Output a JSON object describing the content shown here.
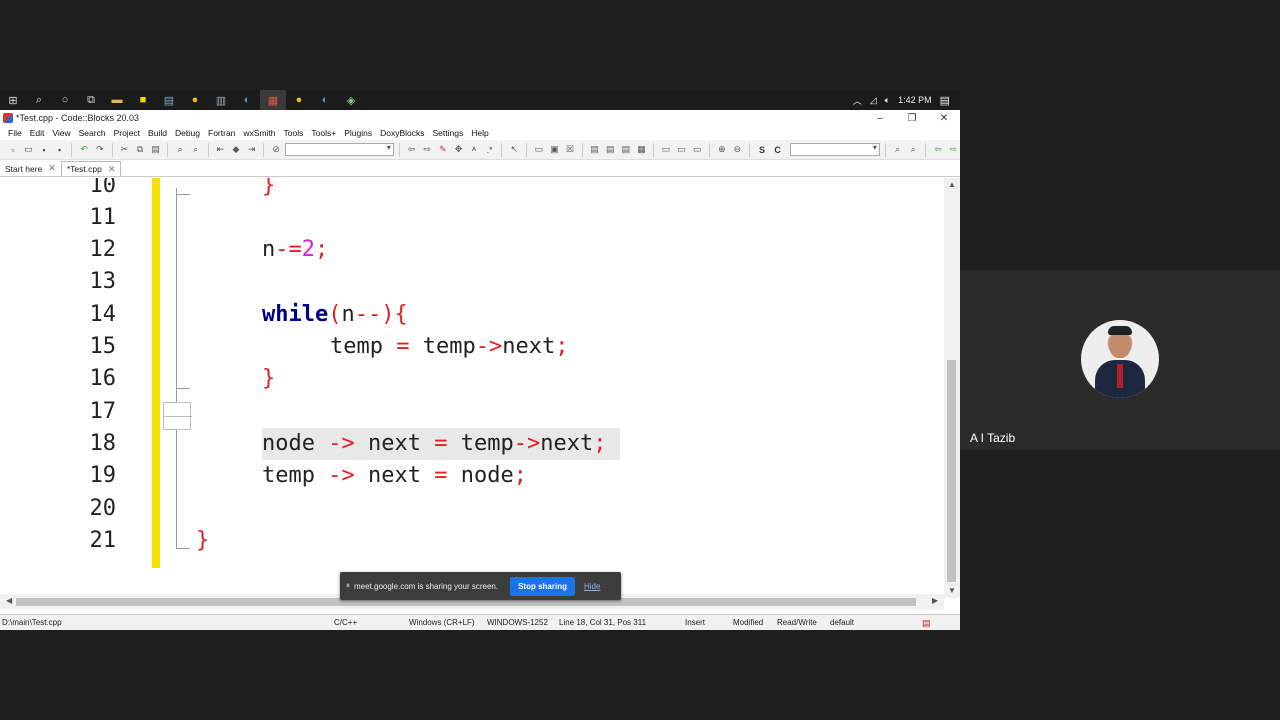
{
  "taskbar": {
    "time": "1:42 PM"
  },
  "window": {
    "title": "*Test.cpp - Code::Blocks 20.03",
    "minimize": "–",
    "restore": "❐",
    "close": "✕"
  },
  "menu": [
    "File",
    "Edit",
    "View",
    "Search",
    "Project",
    "Build",
    "Debug",
    "Fortran",
    "wxSmith",
    "Tools",
    "Tools+",
    "Plugins",
    "DoxyBlocks",
    "Settings",
    "Help"
  ],
  "toolbar": {
    "s_label": "S",
    "c_label": "C"
  },
  "tabs": [
    {
      "label": "Start here",
      "close": "✕"
    },
    {
      "label": "*Test.cpp",
      "close": "✕"
    }
  ],
  "editor": {
    "lines": [
      "10",
      "11",
      "12",
      "13",
      "14",
      "15",
      "16",
      "17",
      "18",
      "19",
      "20",
      "21"
    ]
  },
  "status": {
    "path": "D:\\main\\Test.cpp",
    "language": "C/C++",
    "eol": "Windows (CR+LF)",
    "encoding": "WINDOWS-1252",
    "position": "Line 18, Col 31, Pos 311",
    "mode": "Insert",
    "modified": "Modified",
    "access": "Read/Write",
    "profile": "default"
  },
  "share": {
    "message": "meet.google.com is sharing your screen.",
    "stop": "Stop sharing",
    "hide": "Hide"
  },
  "participant": {
    "name": "A I Tazib"
  }
}
